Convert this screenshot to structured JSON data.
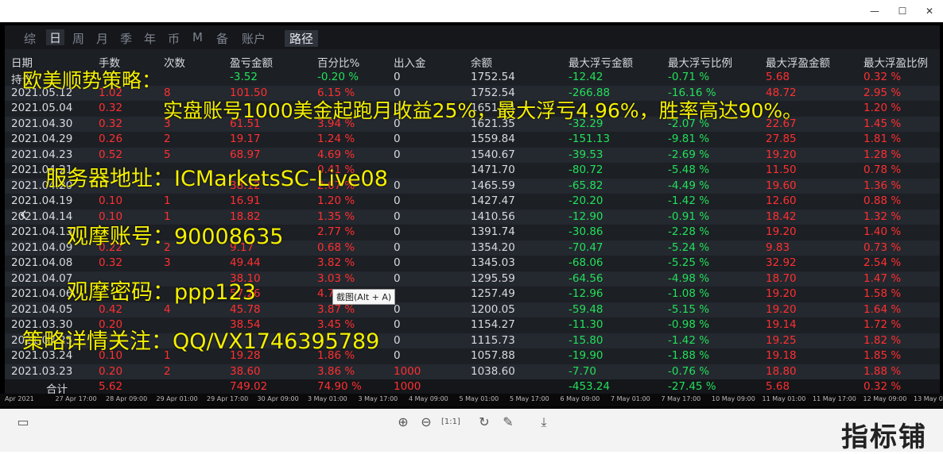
{
  "window": {
    "minimize": "—",
    "maximize": "☐",
    "close": "✕"
  },
  "tabs": [
    "综",
    "日",
    "周",
    "月",
    "季",
    "年",
    "币",
    "M",
    "备",
    "账户",
    "路径"
  ],
  "headers": [
    "日期",
    "手数",
    "次数",
    "盈亏金额",
    "百分比%",
    "出入金",
    "余额",
    "最大浮亏金额",
    "最大浮亏比例",
    "最大浮盈金额",
    "最大浮盈比例"
  ],
  "rows": [
    [
      "持仓",
      "",
      "",
      "-3.52",
      "-0.20 %",
      "0",
      "1752.54",
      "-12.42",
      "-0.71 %",
      "5.68",
      "0.32 %"
    ],
    [
      "2021.05.12",
      "1.02",
      "8",
      "101.50",
      "6.15 %",
      "0",
      "1752.54",
      "-266.88",
      "-16.16 %",
      "48.72",
      "2.95 %"
    ],
    [
      "2021.05.04",
      "0.32",
      "",
      "",
      "",
      "0",
      "1651.04",
      "",
      "",
      "",
      "1.20 %"
    ],
    [
      "2021.04.30",
      "0.32",
      "3",
      "61.51",
      "3.94 %",
      "0",
      "1621.35",
      "-32.29",
      "-2.07 %",
      "22.67",
      "1.45 %"
    ],
    [
      "2021.04.29",
      "0.26",
      "2",
      "19.17",
      "1.24 %",
      "0",
      "1559.84",
      "-151.13",
      "-9.81 %",
      "27.85",
      "1.81 %"
    ],
    [
      "2021.04.23",
      "0.52",
      "5",
      "68.97",
      "4.69 %",
      "0",
      "1540.67",
      "-39.53",
      "-2.69 %",
      "19.20",
      "1.28 %"
    ],
    [
      "2021.04.21",
      "",
      "",
      "",
      "0.41 %",
      "",
      "1471.70",
      "-80.72",
      "-5.48 %",
      "11.50",
      "0.78 %"
    ],
    [
      "2021.04.20",
      "",
      "",
      "38.12",
      "2.67 %",
      "0",
      "1465.59",
      "-65.82",
      "-4.49 %",
      "19.60",
      "1.36 %"
    ],
    [
      "2021.04.19",
      "0.10",
      "1",
      "16.91",
      "1.20 %",
      "0",
      "1427.47",
      "-20.20",
      "-1.42 %",
      "12.60",
      "0.88 %"
    ],
    [
      "2021.04.14",
      "0.10",
      "1",
      "18.82",
      "1.35 %",
      "0",
      "1410.56",
      "-12.90",
      "-0.91 %",
      "18.42",
      "1.32 %"
    ],
    [
      "2021.04.13",
      "",
      "",
      "",
      "2.77 %",
      "0",
      "1391.74",
      "-30.86",
      "-2.28 %",
      "19.20",
      "1.40 %"
    ],
    [
      "2021.04.09",
      "0.22",
      "2",
      "9.17",
      "0.68 %",
      "0",
      "1354.20",
      "-70.47",
      "-5.24 %",
      "9.83",
      "0.73 %"
    ],
    [
      "2021.04.08",
      "0.32",
      "3",
      "49.44",
      "3.82 %",
      "0",
      "1345.03",
      "-68.06",
      "-5.25 %",
      "32.92",
      "2.54 %"
    ],
    [
      "2021.04.07",
      "",
      "",
      "38.10",
      "3.03 %",
      "0",
      "1295.59",
      "-64.56",
      "-4.98 %",
      "18.70",
      "1.47 %"
    ],
    [
      "2021.04.06",
      "",
      "",
      "57.26",
      "4.78 %",
      "",
      "1257.49",
      "-12.96",
      "-1.08 %",
      "19.20",
      "1.58 %"
    ],
    [
      "2021.04.05",
      "0.42",
      "4",
      "45.78",
      "3.87 %",
      "0",
      "1200.05",
      "-59.48",
      "-5.15 %",
      "19.20",
      "1.64 %"
    ],
    [
      "2021.03.30",
      "0.20",
      "",
      "38.54",
      "3.45 %",
      "0",
      "1154.27",
      "-11.30",
      "-0.98 %",
      "19.14",
      "1.72 %"
    ],
    [
      "2021.03.25",
      "",
      "",
      "",
      "",
      "0",
      "1115.73",
      "-15.80",
      "-1.42 %",
      "19.25",
      "1.82 %"
    ],
    [
      "2021.03.24",
      "0.10",
      "1",
      "19.28",
      "1.86 %",
      "0",
      "1057.88",
      "-19.90",
      "-1.88 %",
      "19.18",
      "1.85 %"
    ],
    [
      "2021.03.23",
      "0.20",
      "2",
      "38.60",
      "3.86 %",
      "1000",
      "1038.60",
      "-7.70",
      "-0.76 %",
      "18.80",
      "1.88 %"
    ]
  ],
  "total": [
    "合计",
    "5.62",
    "",
    "749.02",
    "74.90 %",
    "1000",
    "",
    "-453.24",
    "-27.45 %",
    "5.68",
    "0.32 %"
  ],
  "axis_labels": [
    "Apr 2021",
    "27 Apr 17:00",
    "28 Apr 09:00",
    "29 Apr 01:00",
    "29 Apr 17:00",
    "30 Apr 09:00",
    "3 May 01:00",
    "3 May 17:00",
    "4 May 09:00",
    "5 May 01:00",
    "5 May 17:00",
    "6 May 09:00",
    "7 May 01:00",
    "7 May 17:00",
    "10 May 09:00",
    "11 May 01:00",
    "11 May 17:00",
    "12 May 09:00",
    "13 May 01:00"
  ],
  "overlay": {
    "line1": "欧美顺势策略：",
    "line2": "实盘账号1000美金起跑月收益25%，最大浮亏4.96%，胜率高达90%。",
    "line3": "服务器地址：ICMarketsSC-Live08",
    "line4": "观摩账号：90008635",
    "line5": "观摩密码：ppp123",
    "line6": "策略详情关注：QQ/VX1746395789"
  },
  "tooltip": "截图(Alt + A)",
  "brand": "指标铺",
  "colors": {
    "up": "#ff3030",
    "down": "#22e05a",
    "overlay": "#f5f000"
  }
}
